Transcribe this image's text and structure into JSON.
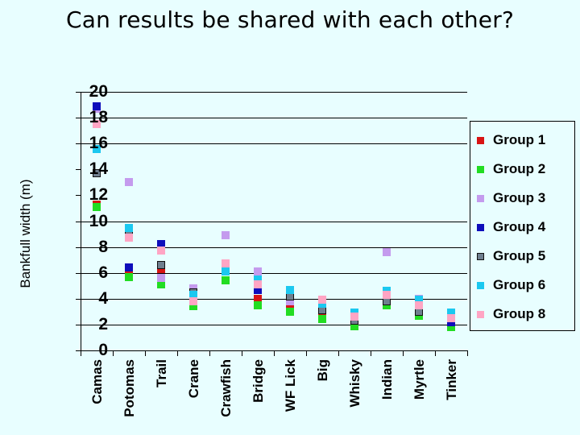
{
  "slide": {
    "background_color": "#e8feff",
    "title": "Can results be shared with each other?"
  },
  "chart_data": {
    "type": "scatter",
    "title": "Can results be shared with each other?",
    "xlabel": "",
    "ylabel": "Bankfull width (m)",
    "ylim": [
      0,
      20
    ],
    "yticks": [
      0,
      2,
      4,
      6,
      8,
      10,
      12,
      14,
      16,
      18,
      20
    ],
    "ytick_labels": [
      "0",
      "2",
      "4",
      "6",
      "8",
      "10",
      "12",
      "14",
      "16",
      "18",
      "20"
    ],
    "gridlines_at": [
      0,
      2,
      4,
      6,
      8,
      10,
      16,
      18,
      20
    ],
    "grid": true,
    "legend_position": "right",
    "categories": [
      "Camas",
      "Potomas",
      "Trail",
      "Crane",
      "Crawfish",
      "Bridge",
      "WF Lick",
      "Big",
      "Whisky",
      "Indian",
      "Myrtle",
      "Tinker"
    ],
    "series": [
      {
        "name": "Group 1",
        "color": "#d81414",
        "values": [
          11.3,
          6.0,
          6.3,
          null,
          null,
          4.0,
          3.4,
          2.8,
          null,
          null,
          null,
          null
        ]
      },
      {
        "name": "Group 2",
        "color": "#22dd22",
        "values": [
          11.1,
          5.7,
          5.1,
          3.4,
          5.4,
          3.5,
          3.0,
          2.4,
          1.9,
          3.5,
          2.7,
          1.8
        ]
      },
      {
        "name": "Group 3",
        "color": "#c49bee",
        "values": [
          18.7,
          13.0,
          5.6,
          4.8,
          8.9,
          6.1,
          3.8,
          null,
          null,
          7.6,
          4.0,
          null
        ]
      },
      {
        "name": "Group 4",
        "color": "#0d0dbb",
        "values": [
          18.9,
          6.4,
          8.2,
          4.1,
          6.4,
          4.7,
          null,
          null,
          null,
          null,
          null,
          2.2
        ]
      },
      {
        "name": "Group 5",
        "color": "#6f7f8f",
        "values": [
          13.7,
          9.1,
          6.6,
          4.5,
          null,
          null,
          4.2,
          3.1,
          2.3,
          3.8,
          3.0,
          null
        ]
      },
      {
        "name": "Group 6",
        "color": "#1bc8f0",
        "values": [
          15.6,
          9.5,
          null,
          4.3,
          6.1,
          5.5,
          4.7,
          3.6,
          2.9,
          4.6,
          3.9,
          2.9
        ]
      },
      {
        "name": "Group 8",
        "color": "#ffa5c4",
        "values": [
          17.5,
          8.7,
          7.7,
          3.8,
          6.7,
          5.1,
          null,
          3.9,
          2.6,
          4.3,
          3.5,
          2.5
        ]
      }
    ]
  },
  "legend": {
    "entries": [
      {
        "label": "Group 1",
        "color": "#d81414"
      },
      {
        "label": "Group 2",
        "color": "#22dd22"
      },
      {
        "label": "Group 3",
        "color": "#c49bee"
      },
      {
        "label": "Group 4",
        "color": "#0d0dbb"
      },
      {
        "label": "Group 5",
        "color": "#6f7f8f"
      },
      {
        "label": "Group 6",
        "color": "#1bc8f0"
      },
      {
        "label": "Group 8",
        "color": "#ffa5c4"
      }
    ]
  }
}
